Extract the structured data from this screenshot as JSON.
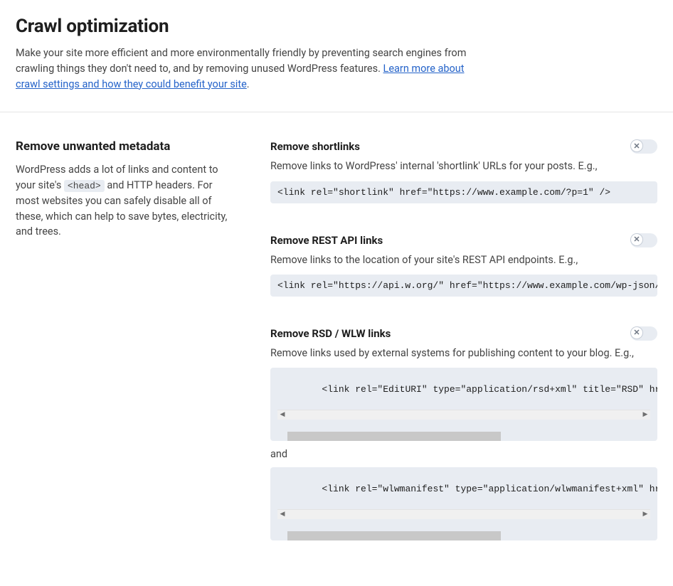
{
  "header": {
    "title": "Crawl optimization",
    "desc_before_link": "Make your site more efficient and more environmentally friendly by preventing search engines from crawling things they don't need to, and by removing unused WordPress features. ",
    "link_text": "Learn more about crawl settings and how they could benefit your site",
    "desc_after_link": "."
  },
  "sidebar": {
    "title": "Remove unwanted metadata",
    "desc_1": "WordPress adds a lot of links and content to your site's ",
    "desc_code": "<head>",
    "desc_2": " and HTTP headers. For most websites you can safely disable all of these, which can help to save bytes, electricity, and trees."
  },
  "settings": [
    {
      "title": "Remove shortlinks",
      "desc": "Remove links to WordPress' internal 'shortlink' URLs for your posts. E.g.,",
      "code": "<link rel=\"shortlink\" href=\"https://www.example.com/?p=1\" />",
      "scroll": false
    },
    {
      "title": "Remove REST API links",
      "desc": "Remove links to the location of your site's REST API endpoints. E.g.,",
      "code": "<link rel=\"https://api.w.org/\" href=\"https://www.example.com/wp-json/\" />",
      "scroll": false
    },
    {
      "title": "Remove RSD / WLW links",
      "desc": "Remove links used by external systems for publishing content to your blog. E.g.,",
      "code": "<link rel=\"EditURI\" type=\"application/rsd+xml\" title=\"RSD\" href=\"https://www.",
      "scroll": true,
      "and": "and",
      "code2": "<link rel=\"wlwmanifest\" type=\"application/wlwmanifest+xml\" href=\"https://www.",
      "scroll2": true
    }
  ]
}
